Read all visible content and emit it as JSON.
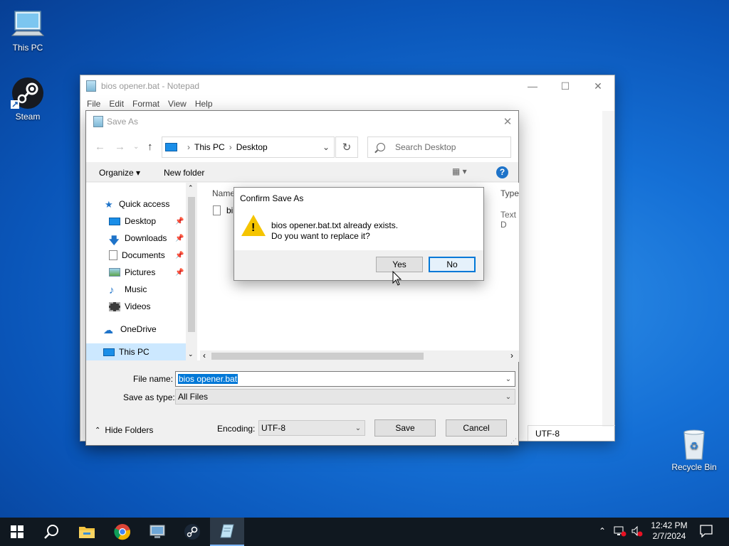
{
  "desktop": {
    "icons": [
      {
        "label": "This PC"
      },
      {
        "label": "Steam"
      },
      {
        "label": "Recycle Bin"
      }
    ]
  },
  "notepad": {
    "title": "bios opener.bat - Notepad",
    "menu": [
      "File",
      "Edit",
      "Format",
      "View",
      "Help"
    ],
    "encoding_status": "UTF-8",
    "controls": {
      "minimize": "—",
      "maximize": "☐",
      "close": "✕"
    }
  },
  "save_as": {
    "title": "Save As",
    "close": "✕",
    "address": {
      "root": "This PC",
      "folder": "Desktop"
    },
    "search_placeholder": "Search Desktop",
    "toolbar": {
      "organize": "Organize ▾",
      "new_folder": "New folder"
    },
    "nav_items": [
      {
        "label": "Quick access"
      },
      {
        "label": "Desktop"
      },
      {
        "label": "Downloads"
      },
      {
        "label": "Documents"
      },
      {
        "label": "Pictures"
      },
      {
        "label": "Music"
      },
      {
        "label": "Videos"
      },
      {
        "label": "OneDrive"
      },
      {
        "label": "This PC"
      }
    ],
    "columns": {
      "name": "Name",
      "type": "Type"
    },
    "file_row": {
      "name": "bi",
      "type": "Text D"
    },
    "file_name_label": "File name:",
    "file_name_value": "bios opener.bat",
    "save_type_label": "Save as type:",
    "save_type_value": "All Files",
    "hide_folders": "Hide Folders",
    "encoding_label": "Encoding:",
    "encoding_value": "UTF-8",
    "save_button": "Save",
    "cancel_button": "Cancel"
  },
  "confirm": {
    "title": "Confirm Save As",
    "line1": "bios opener.bat.txt already exists.",
    "line2": "Do you want to replace it?",
    "yes": "Yes",
    "no": "No"
  },
  "taskbar": {
    "time": "12:42 PM",
    "date": "2/7/2024"
  },
  "colors": {
    "accent": "#0078d7",
    "warning": "#f5c400",
    "taskbar": "#101820"
  }
}
